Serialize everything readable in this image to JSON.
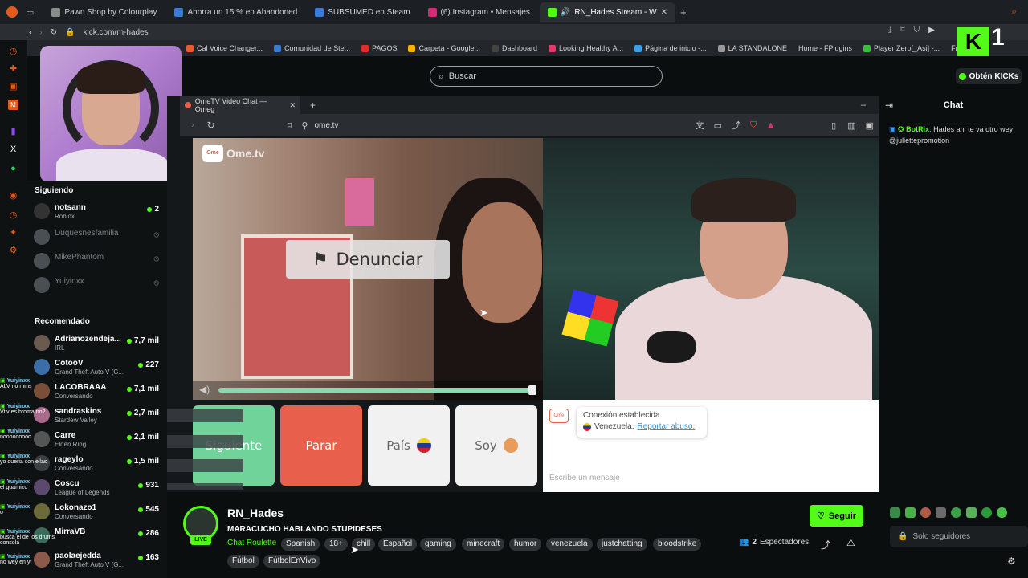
{
  "browser": {
    "tabs": [
      {
        "label": "Pawn Shop by Colourplay",
        "color": "#8a8a8a"
      },
      {
        "label": "Ahorra un 15 % en Abandoned",
        "color": "#3a7bd5"
      },
      {
        "label": "SUBSUMED en Steam",
        "color": "#3a7bd5"
      },
      {
        "label": "(6) Instagram • Mensajes",
        "color": "#d62976"
      },
      {
        "label": "RN_Hades Stream - W",
        "color": "#53fc18"
      }
    ],
    "url": "kick.com/rn-hades",
    "bookmarks": [
      "Cal Voice Changer...",
      "Comunidad de Ste...",
      "PAGOS",
      "Carpeta - Google...",
      "Dashboard",
      "Looking Healthy A...",
      "Página de inicio -...",
      "LA STANDALONE",
      "Home - FPlugins",
      "Player Zero[_Asi] -...",
      "Free fo..."
    ]
  },
  "header": {
    "search_placeholder": "Buscar",
    "get_kicks": "Obtén KICKs",
    "kick_count": "1"
  },
  "sidebar": {
    "following_title": "Siguiendo",
    "following": [
      {
        "name": "notsann",
        "sub": "Roblox",
        "viewers": "2",
        "live": true
      },
      {
        "name": "Duquesnesfamilia",
        "sub": "",
        "viewers": "",
        "live": false
      },
      {
        "name": "MikePhantom",
        "sub": "",
        "viewers": "",
        "live": false
      },
      {
        "name": "Yuiyinxx",
        "sub": "",
        "viewers": "",
        "live": false
      }
    ],
    "recommended_title": "Recomendado",
    "recommended": [
      {
        "name": "Adrianozendeja...",
        "sub": "IRL",
        "viewers": "7,7 mil"
      },
      {
        "name": "CotooV",
        "sub": "Grand Theft Auto V (G...",
        "viewers": "227"
      },
      {
        "name": "LACOBRAAA",
        "sub": "Conversando",
        "viewers": "7,1 mil"
      },
      {
        "name": "sandraskins",
        "sub": "Stardew Valley",
        "viewers": "2,7 mil"
      },
      {
        "name": "Carre",
        "sub": "Elden Ring",
        "viewers": "2,1 mil"
      },
      {
        "name": "rageylo",
        "sub": "Conversando",
        "viewers": "1,5 mil"
      },
      {
        "name": "Coscu",
        "sub": "League of Legends",
        "viewers": "931"
      },
      {
        "name": "Lokonazo1",
        "sub": "Conversando",
        "viewers": "545"
      },
      {
        "name": "MirraVB",
        "sub": "",
        "viewers": "286"
      },
      {
        "name": "paolaejedda",
        "sub": "Grand Theft Auto V (G...",
        "viewers": "163"
      }
    ]
  },
  "overlay_chat": [
    {
      "user": "Yuiyinxx",
      "msg": "ALV no mms"
    },
    {
      "user": "Yuiyinxx",
      "msg": "Vtiv es broma no?"
    },
    {
      "user": "Yuiyinxx",
      "msg": "nooooooooo"
    },
    {
      "user": "Yuiyinxx",
      "msg": "yo queria con ellas"
    },
    {
      "user": "Yuiyinxx",
      "msg": "el guarnizo"
    },
    {
      "user": "Yuiyinxx",
      "msg": "o"
    },
    {
      "user": "Yuiyinxx",
      "msg": "busca el de los drums consola"
    },
    {
      "user": "Yuiyinxx",
      "msg": "no wey en yt"
    }
  ],
  "inner_browser": {
    "tab_label": "OmeTV Video Chat — Omeg",
    "url": "ome.tv",
    "logo": "Ome.tv",
    "report": "Denunciar",
    "buttons": {
      "next": "Siguiente",
      "stop": "Parar",
      "country": "País",
      "me": "Soy"
    },
    "connection": "Conexión establecida.",
    "country_name": "Venezuela.",
    "report_abuse": "Reportar abuso.",
    "msg_placeholder": "Escribe un mensaje",
    "volume_percent": 100
  },
  "chat": {
    "title": "Chat",
    "messages": [
      {
        "user": "BotRix",
        "text": "Hades ahi te va otro wey @juliettepromotion"
      }
    ],
    "input_placeholder": "Solo seguidores"
  },
  "stream": {
    "channel": "RN_Hades",
    "title": "MARACUCHO HABLANDO STUPIDESES",
    "live_badge": "LIVE",
    "category": "Chat Roulette",
    "tags": [
      "Spanish",
      "18+",
      "chill",
      "Español",
      "gaming",
      "minecraft",
      "humor",
      "venezuela",
      "justchatting",
      "bloodstrike",
      "Fútbol",
      "FútbolEnVivo"
    ],
    "follow": "Seguir",
    "viewers": "2",
    "viewers_label": "Espectadores"
  },
  "colors": {
    "kick_green": "#53fc18",
    "stop_red": "#e8604c",
    "next_green": "#6fd39a"
  }
}
